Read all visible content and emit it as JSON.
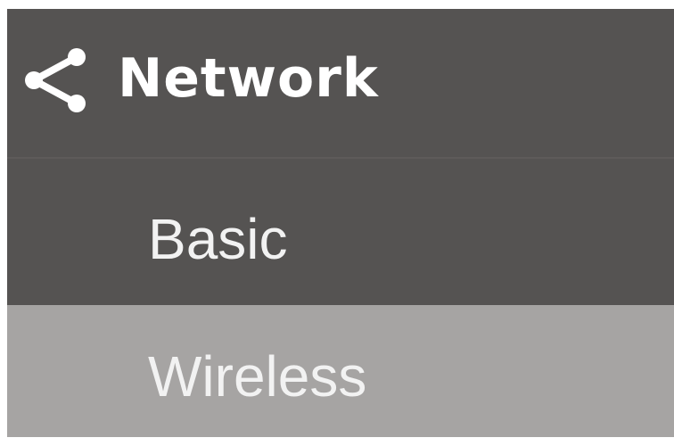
{
  "nav": {
    "header": {
      "icon": "share-icon",
      "title": "Network"
    },
    "items": [
      {
        "label": "Basic",
        "selected": false
      },
      {
        "label": "Wireless",
        "selected": true
      }
    ]
  },
  "colors": {
    "panel_background": "#555352",
    "selected_background": "#a6a4a3",
    "text": "#ffffff"
  }
}
